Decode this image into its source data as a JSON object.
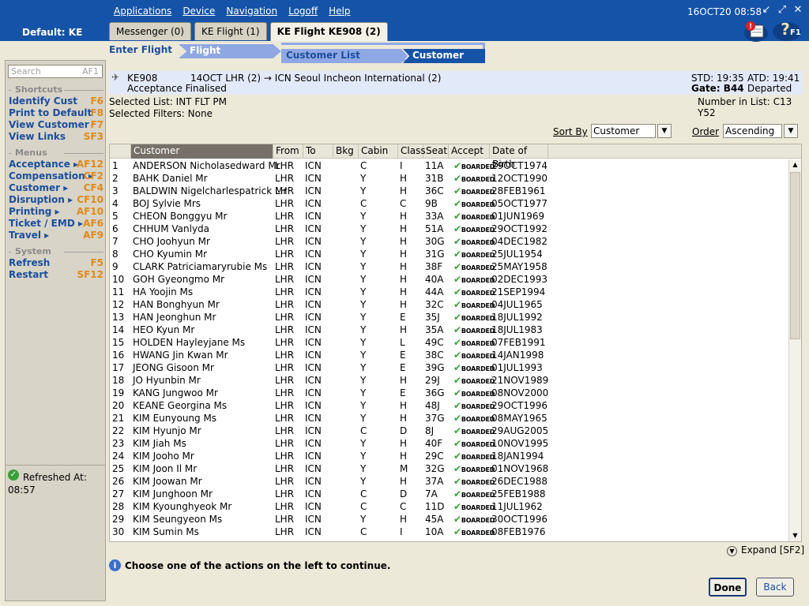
{
  "app": {
    "default_label": "Default: KE",
    "menu": [
      "Applications",
      "Device",
      "Navigation",
      "Logoff",
      "Help"
    ],
    "clock": "16OCT20 08:58",
    "help_badge": "F1"
  },
  "tabs": [
    {
      "label": "Messenger (0)"
    },
    {
      "label": "KE Flight (1)"
    },
    {
      "label": "KE Flight KE908 (2)"
    }
  ],
  "left": {
    "search_placeholder": "Search",
    "search_key": "AF1",
    "shortcuts_head": "Shortcuts",
    "shortcuts": [
      {
        "label": "Identify Cust",
        "key": "F6"
      },
      {
        "label": "Print to Default",
        "key": "F8"
      },
      {
        "label": "View Customer",
        "key": "F7"
      },
      {
        "label": "View Links",
        "key": "SF3"
      }
    ],
    "menus_head": "Menus",
    "menus": [
      {
        "label": "Acceptance",
        "key": "AF12"
      },
      {
        "label": "Compensation",
        "key": "CF2"
      },
      {
        "label": "Customer",
        "key": "CF4"
      },
      {
        "label": "Disruption",
        "key": "CF10"
      },
      {
        "label": "Printing",
        "key": "AF10"
      },
      {
        "label": "Ticket / EMD",
        "key": "AF6"
      },
      {
        "label": "Travel",
        "key": "AF9"
      }
    ],
    "system_head": "System",
    "system": [
      {
        "label": "Refresh",
        "key": "F5"
      },
      {
        "label": "Restart",
        "key": "SF12"
      }
    ],
    "refresh_label": "Refreshed At:",
    "refresh_time": "08:57"
  },
  "breadcrumb": [
    "Enter Flight",
    "Flight Information",
    "Customer List Selection",
    "Customer List"
  ],
  "flight": {
    "number": "KE908",
    "route": "14OCT LHR (2) → ICN Seoul Incheon International (2)",
    "status": "Acceptance Finalised",
    "std": "STD: 19:35",
    "atd": "ATD: 19:41",
    "gate": "Gate: B44",
    "flight_state": "Departed"
  },
  "list_info": {
    "selected_list": "Selected List: INT FLT PM",
    "selected_filters": "Selected Filters: None",
    "number_in_list": "Number in List: C13 Y52",
    "sort_by_label": "Sort By",
    "sort_by_value": "Customer",
    "order_label": "Order",
    "order_value": "Ascending"
  },
  "table": {
    "columns": [
      "Customer",
      "From",
      "To",
      "Bkg",
      "Cabin",
      "Class",
      "Seat",
      "Accept",
      "Date of Birth"
    ],
    "accept_text": "BOARDED",
    "rows": [
      [
        "1",
        "ANDERSON Nicholasedward Mr",
        "LHR",
        "ICN",
        "",
        "C",
        "I",
        "11A",
        "29OCT1974"
      ],
      [
        "2",
        "BAHK Daniel Mr",
        "LHR",
        "ICN",
        "",
        "Y",
        "H",
        "31B",
        "12OCT1990"
      ],
      [
        "3",
        "BALDWIN Nigelcharlespatrick Mr",
        "LHR",
        "ICN",
        "",
        "Y",
        "H",
        "36C",
        "28FEB1961"
      ],
      [
        "4",
        "BOJ Sylvie Mrs",
        "LHR",
        "ICN",
        "",
        "C",
        "C",
        "9B",
        "05OCT1977"
      ],
      [
        "5",
        "CHEON Bonggyu Mr",
        "LHR",
        "ICN",
        "",
        "Y",
        "H",
        "33A",
        "01JUN1969"
      ],
      [
        "6",
        "CHHUM Vanlyda",
        "LHR",
        "ICN",
        "",
        "Y",
        "H",
        "51A",
        "29OCT1992"
      ],
      [
        "7",
        "CHO Joohyun Mr",
        "LHR",
        "ICN",
        "",
        "Y",
        "H",
        "30G",
        "04DEC1982"
      ],
      [
        "8",
        "CHO Kyumin Mr",
        "LHR",
        "ICN",
        "",
        "Y",
        "H",
        "31G",
        "25JUL1954"
      ],
      [
        "9",
        "CLARK Patriciamaryrubie Ms",
        "LHR",
        "ICN",
        "",
        "Y",
        "H",
        "38F",
        "25MAY1958"
      ],
      [
        "10",
        "GOH Gyeongmo Mr",
        "LHR",
        "ICN",
        "",
        "Y",
        "H",
        "40A",
        "02DEC1993"
      ],
      [
        "11",
        "HA Yoojin Ms",
        "LHR",
        "ICN",
        "",
        "Y",
        "H",
        "44A",
        "21SEP1994"
      ],
      [
        "12",
        "HAN Bonghyun Mr",
        "LHR",
        "ICN",
        "",
        "Y",
        "H",
        "32C",
        "04JUL1965"
      ],
      [
        "13",
        "HAN Jeonghun Mr",
        "LHR",
        "ICN",
        "",
        "Y",
        "E",
        "35J",
        "18JUL1992"
      ],
      [
        "14",
        "HEO Kyun Mr",
        "LHR",
        "ICN",
        "",
        "Y",
        "H",
        "35A",
        "18JUL1983"
      ],
      [
        "15",
        "HOLDEN Hayleyjane Ms",
        "LHR",
        "ICN",
        "",
        "Y",
        "L",
        "49C",
        "07FEB1991"
      ],
      [
        "16",
        "HWANG Jin Kwan Mr",
        "LHR",
        "ICN",
        "",
        "Y",
        "E",
        "38C",
        "14JAN1998"
      ],
      [
        "17",
        "JEONG Gisoon Mr",
        "LHR",
        "ICN",
        "",
        "Y",
        "E",
        "39G",
        "01JUL1993"
      ],
      [
        "18",
        "JO Hyunbin Mr",
        "LHR",
        "ICN",
        "",
        "Y",
        "H",
        "29J",
        "21NOV1989"
      ],
      [
        "19",
        "KANG Jungwoo Mr",
        "LHR",
        "ICN",
        "",
        "Y",
        "E",
        "36G",
        "08NOV2000"
      ],
      [
        "20",
        "KEANE Georgina Ms",
        "LHR",
        "ICN",
        "",
        "Y",
        "H",
        "48J",
        "29OCT1996"
      ],
      [
        "21",
        "KIM Eunyoung Ms",
        "LHR",
        "ICN",
        "",
        "Y",
        "H",
        "37G",
        "08MAY1965"
      ],
      [
        "22",
        "KIM Hyunjo Mr",
        "LHR",
        "ICN",
        "",
        "C",
        "D",
        "8J",
        "29AUG2005"
      ],
      [
        "23",
        "KIM Jiah Ms",
        "LHR",
        "ICN",
        "",
        "Y",
        "H",
        "40F",
        "10NOV1995"
      ],
      [
        "24",
        "KIM Jooho Mr",
        "LHR",
        "ICN",
        "",
        "Y",
        "H",
        "29C",
        "18JAN1994"
      ],
      [
        "25",
        "KIM Joon Il Mr",
        "LHR",
        "ICN",
        "",
        "Y",
        "M",
        "32G",
        "01NOV1968"
      ],
      [
        "26",
        "KIM Joowan Mr",
        "LHR",
        "ICN",
        "",
        "Y",
        "H",
        "37A",
        "26DEC1988"
      ],
      [
        "27",
        "KIM Junghoon Mr",
        "LHR",
        "ICN",
        "",
        "C",
        "D",
        "7A",
        "25FEB1988"
      ],
      [
        "28",
        "KIM Kyounghyeok Mr",
        "LHR",
        "ICN",
        "",
        "C",
        "C",
        "11D",
        "11JUL1962"
      ],
      [
        "29",
        "KIM Seungyeon Ms",
        "LHR",
        "ICN",
        "",
        "Y",
        "H",
        "45A",
        "30OCT1996"
      ],
      [
        "30",
        "KIM Sumin Ms",
        "LHR",
        "ICN",
        "",
        "C",
        "I",
        "10A",
        "08FEB1976"
      ]
    ]
  },
  "footer": {
    "expand": "Expand [SF2]",
    "hint": "Choose one of the actions on the left to continue.",
    "done": "Done",
    "back": "Back"
  }
}
